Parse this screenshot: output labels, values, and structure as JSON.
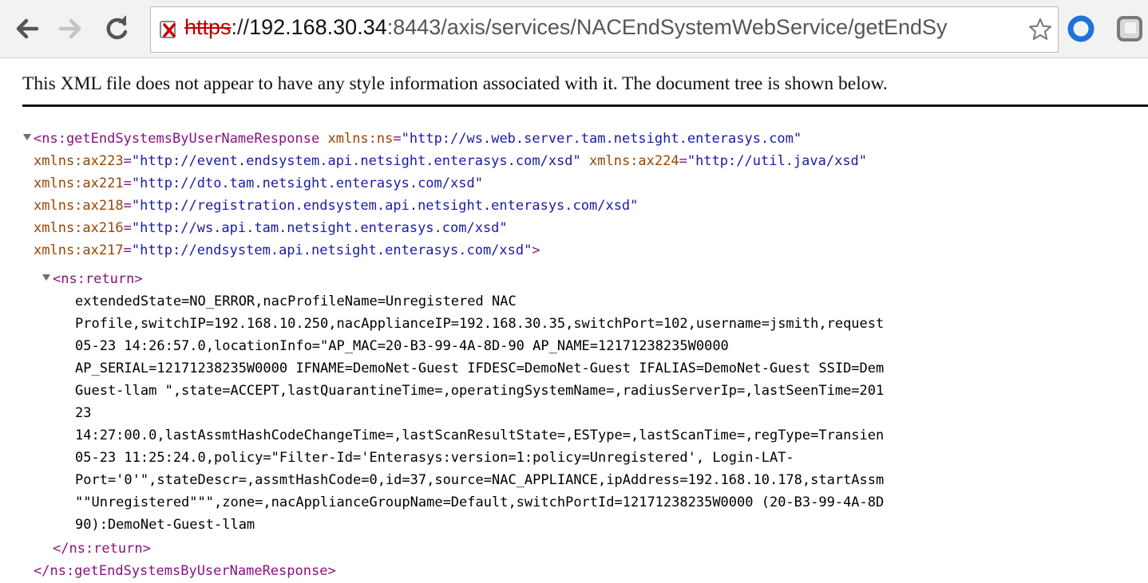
{
  "browser": {
    "url": {
      "scheme": "https",
      "separator": "://",
      "host": "192.168.30.34",
      "rest": ":8443/axis/services/NACEndSystemWebService/getEndSy"
    },
    "icons": {
      "back": "arrow-left-icon",
      "forward": "arrow-right-icon",
      "reload": "reload-icon",
      "security": "insecure-lock-icon",
      "bookmark": "star-icon",
      "extension1": "circle-extension-icon",
      "extension2": "square-extension-icon"
    },
    "colors": {
      "insecure": "#cc0000",
      "extension1": "#1e73d8"
    }
  },
  "notice": "This XML file does not appear to have any style information associated with it. The document tree is shown below.",
  "xml": {
    "root_open": "<ns:getEndSystemsByUserNameResponse",
    "root_name": "ns:getEndSystemsByUserNameResponse",
    "attrs": [
      {
        "name": "xmlns:ns",
        "value": "\"http://ws.web.server.tam.netsight.enterasys.com\""
      },
      {
        "name": "xmlns:ax223",
        "value": "\"http://event.endsystem.api.netsight.enterasys.com/xsd\""
      },
      {
        "name": "xmlns:ax224",
        "value": "\"http://util.java/xsd\""
      },
      {
        "name": "xmlns:ax221",
        "value": "\"http://dto.tam.netsight.enterasys.com/xsd\""
      },
      {
        "name": "xmlns:ax218",
        "value": "\"http://registration.endsystem.api.netsight.enterasys.com/xsd\""
      },
      {
        "name": "xmlns:ax216",
        "value": "\"http://ws.api.tam.netsight.enterasys.com/xsd\""
      },
      {
        "name": "xmlns:ax217",
        "value": "\"http://endsystem.api.netsight.enterasys.com/xsd\""
      }
    ],
    "child_open": "<ns:return>",
    "child_close": "</ns:return>",
    "root_close": "</ns:getEndSystemsByUserNameResponse>",
    "text_lines": [
      "extendedState=NO_ERROR,nacProfileName=Unregistered NAC",
      "Profile,switchIP=192.168.10.250,nacApplianceIP=192.168.30.35,switchPort=102,username=jsmith,request",
      "05-23 14:26:57.0,locationInfo=\"AP_MAC=20-B3-99-4A-8D-90 AP_NAME=12171238235W0000",
      "AP_SERIAL=12171238235W0000 IFNAME=DemoNet-Guest IFDESC=DemoNet-Guest IFALIAS=DemoNet-Guest SSID=Dem",
      "Guest-llam \",state=ACCEPT,lastQuarantineTime=,operatingSystemName=,radiusServerIp=,lastSeenTime=201",
      "23",
      "14:27:00.0,lastAssmtHashCodeChangeTime=,lastScanResultState=,ESType=,lastScanTime=,regType=Transien",
      "05-23 11:25:24.0,policy=\"Filter-Id='Enterasys:version=1:policy=Unregistered', Login-LAT-",
      "Port='0'\",stateDescr=,assmtHashCode=0,id=37,source=NAC_APPLIANCE,ipAddress=192.168.10.178,startAssm",
      "\"\"Unregistered\"\"\",zone=,nacApplianceGroupName=Default,switchPortId=12171238235W0000 (20-B3-99-4A-8D",
      "90):DemoNet-Guest-llam"
    ]
  },
  "xml_colors": {
    "tag": "#881280",
    "attr_name": "#994500",
    "attr_value": "#1a1aa6"
  }
}
